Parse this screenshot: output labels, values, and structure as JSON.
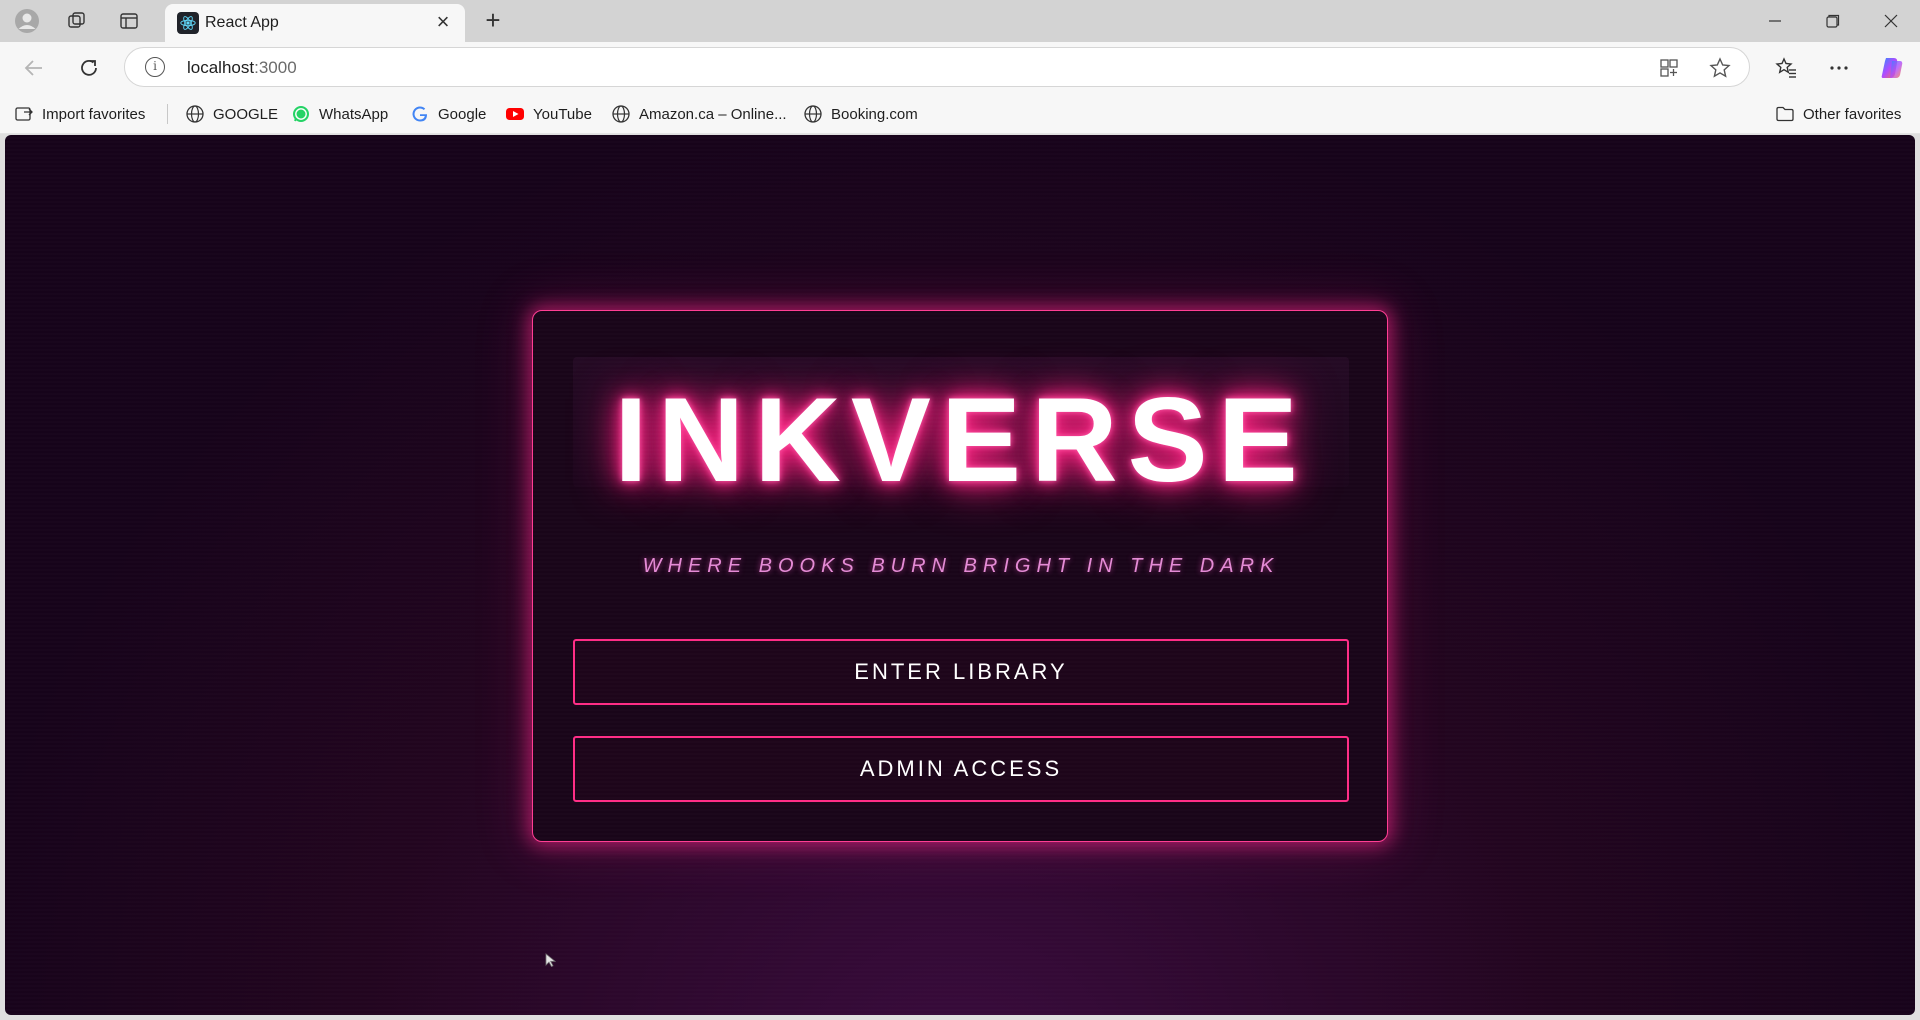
{
  "browser": {
    "tab": {
      "title": "React App",
      "favicon": "react-icon"
    },
    "address_bar": {
      "host": "localhost",
      "port": ":3000"
    },
    "bookmarks": [
      {
        "label": "Import favorites",
        "icon": "import-icon"
      },
      {
        "label": "GOOGLE",
        "icon": "globe-icon"
      },
      {
        "label": "WhatsApp",
        "icon": "whatsapp-icon"
      },
      {
        "label": "Google",
        "icon": "google-icon"
      },
      {
        "label": "YouTube",
        "icon": "youtube-icon"
      },
      {
        "label": "Amazon.ca – Online...",
        "icon": "globe-icon"
      },
      {
        "label": "Booking.com",
        "icon": "globe-icon"
      }
    ],
    "other_favorites": "Other favorites"
  },
  "page": {
    "logo": "INKVERSE",
    "tagline": "WHERE BOOKS BURN BRIGHT IN THE DARK",
    "enter_button": "ENTER LIBRARY",
    "admin_button": "ADMIN ACCESS"
  },
  "colors": {
    "neon_pink": "#ff2d86",
    "tagline": "#e58bd6",
    "background": "#16031a"
  }
}
